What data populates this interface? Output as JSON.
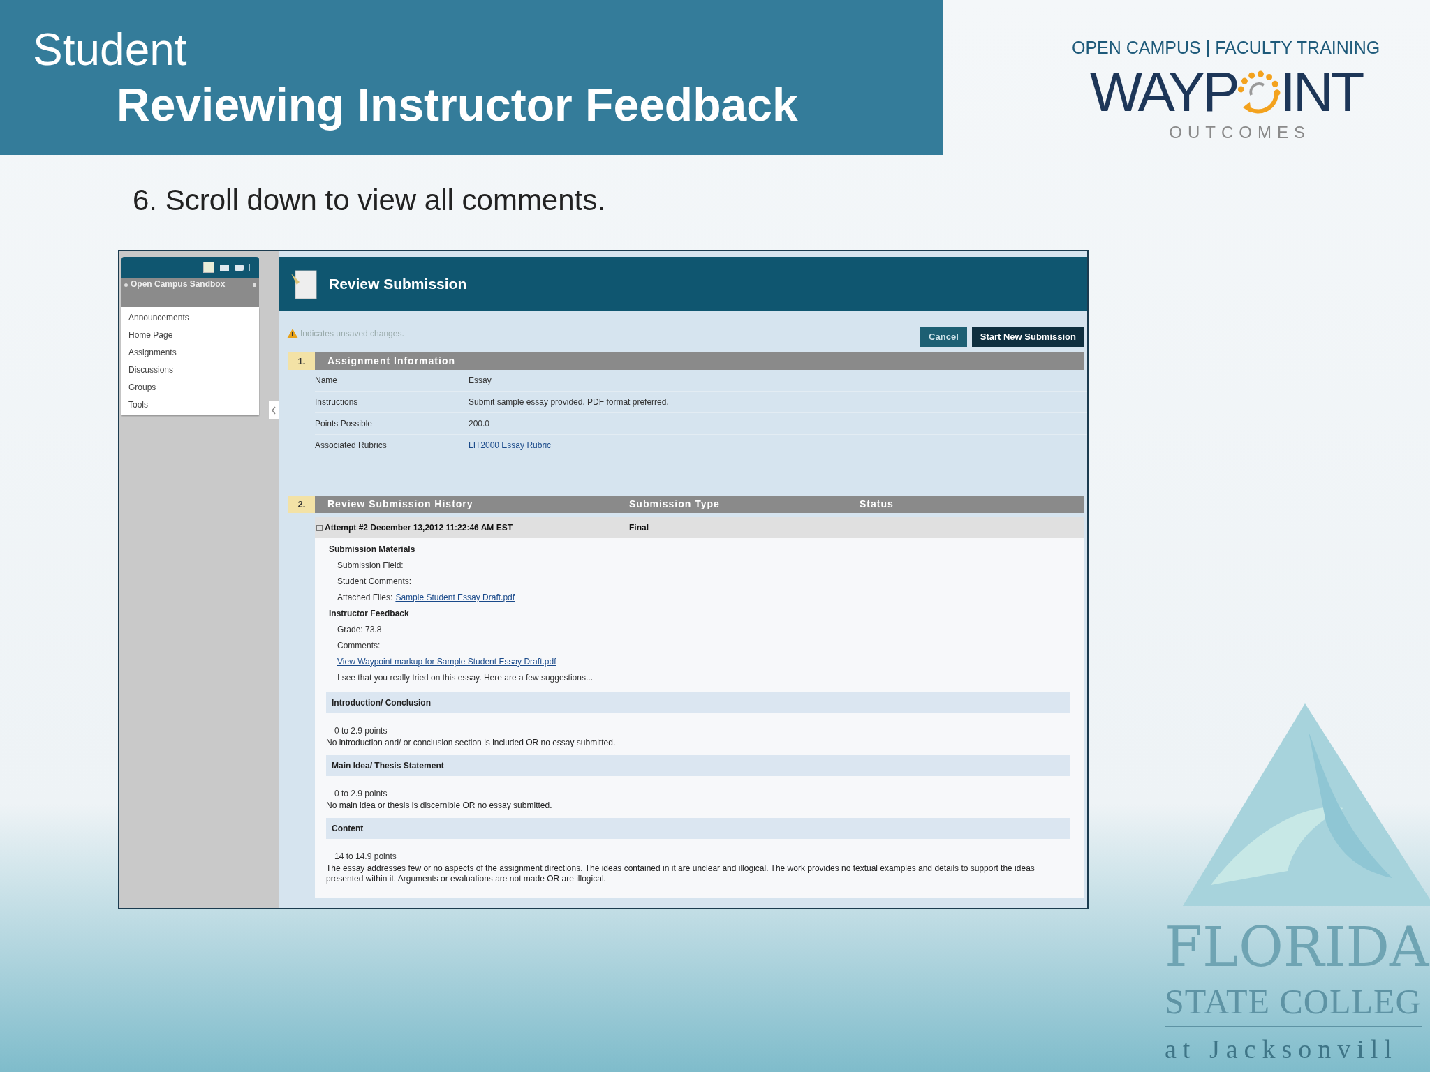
{
  "slide": {
    "section": "Student",
    "title": "Reviewing Instructor Feedback",
    "step": "6. Scroll down to view all comments."
  },
  "branding": {
    "tagline": "OPEN CAMPUS | FACULTY TRAINING",
    "logo_left": "WAYP",
    "logo_right": "INT",
    "logo_sub": "OUTCOMES",
    "college": [
      "FLORIDA",
      "STATE COLLEG",
      "at Jacksonvill"
    ]
  },
  "screenshot": {
    "course": "Open Campus Sandbox",
    "menu": [
      "Announcements",
      "Home Page",
      "Assignments",
      "Discussions",
      "Groups",
      "Tools"
    ],
    "page_title": "Review Submission",
    "unsaved_note": "Indicates unsaved changes.",
    "buttons": [
      {
        "label": "Cancel",
        "kind": "secondary"
      },
      {
        "label": "Start New Submission",
        "kind": "primary"
      }
    ],
    "assignment": {
      "number": "1.",
      "title": "Assignment Information",
      "fields": [
        {
          "label": "Name",
          "value": "Essay",
          "kind": "text"
        },
        {
          "label": "Instructions",
          "value": "Submit sample essay provided. PDF format preferred.",
          "kind": "text"
        },
        {
          "label": "Points Possible",
          "value": "200.0",
          "kind": "text"
        },
        {
          "label": "Associated Rubrics",
          "value": "LIT2000 Essay Rubric",
          "kind": "link"
        }
      ]
    },
    "history": {
      "number": "2.",
      "columns": [
        "Review Submission History",
        "Submission Type",
        "Status"
      ],
      "attempt": {
        "title": "Attempt #2 December 13,2012 11:22:46 AM EST",
        "type": "Final",
        "expanded": true
      },
      "lines": [
        {
          "kind": "heading",
          "text": "Submission Materials"
        },
        {
          "kind": "item",
          "text": "Submission Field:"
        },
        {
          "kind": "item",
          "text": "Student Comments:"
        },
        {
          "kind": "item",
          "text": "Attached Files:",
          "link": "Sample Student Essay Draft.pdf"
        },
        {
          "kind": "heading",
          "text": "Instructor Feedback"
        },
        {
          "kind": "item",
          "text": "Grade: 73.8"
        },
        {
          "kind": "item",
          "text": "Comments:"
        },
        {
          "kind": "link",
          "text": "View Waypoint markup for Sample Student Essay Draft.pdf"
        },
        {
          "kind": "item",
          "text": "I see that you really tried on this essay. Here are a few suggestions..."
        }
      ],
      "rubric": [
        {
          "criterion": "Introduction/ Conclusion",
          "points": "0 to 2.9 points",
          "description": "No introduction and/ or conclusion section is included OR no essay submitted."
        },
        {
          "criterion": "Main Idea/ Thesis Statement",
          "points": "0 to 2.9 points",
          "description": "No main idea or thesis is discernible OR no essay submitted."
        },
        {
          "criterion": "Content",
          "points": "14 to 14.9 points",
          "description": "The essay addresses few or no aspects of the assignment directions. The ideas contained in it are unclear and illogical. The work provides no textual examples and details to support the ideas presented within it. Arguments or evaluations are not made OR are illogical."
        }
      ]
    }
  }
}
